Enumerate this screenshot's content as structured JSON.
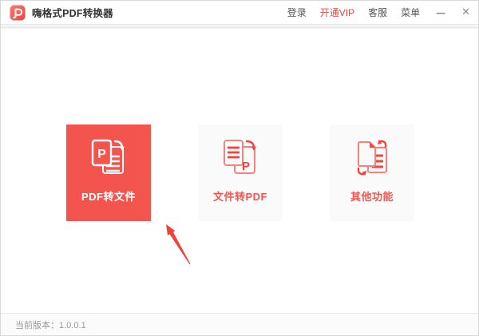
{
  "titlebar": {
    "title": "嗨格式PDF转换器",
    "menu": [
      {
        "label": "登录"
      },
      {
        "label": "开通VIP"
      },
      {
        "label": "客服"
      },
      {
        "label": "菜单"
      }
    ],
    "minimize_icon": "—",
    "close_icon": "✕"
  },
  "cards": [
    {
      "label": "PDF转文件",
      "selected": true
    },
    {
      "label": "文件转PDF",
      "selected": false
    },
    {
      "label": "其他功能",
      "selected": false
    }
  ],
  "footer": {
    "version": "当前版本：1.0.0.1"
  },
  "colors": {
    "accent": "#f4544e",
    "accent_strong": "#f4433c",
    "accent_soft": "#f8817b",
    "card_bg": "#fafafa",
    "arrow": "#f0413b"
  }
}
